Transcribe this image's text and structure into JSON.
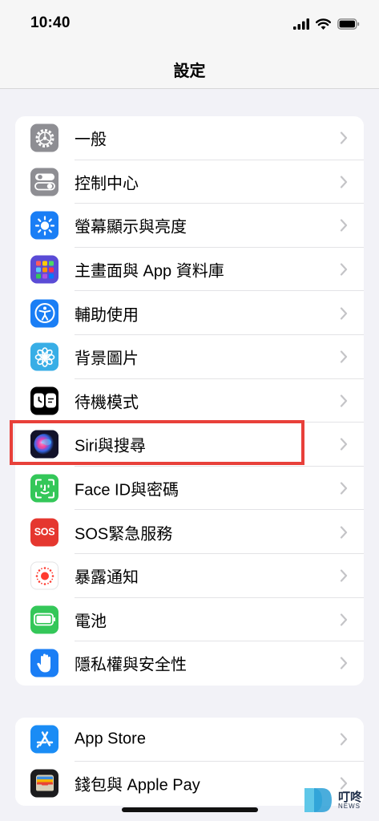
{
  "status_bar": {
    "time": "10:40"
  },
  "nav": {
    "title": "設定"
  },
  "groups": [
    {
      "items": [
        {
          "label": "一般",
          "icon": "gear-icon",
          "icon_bg": "#8e8e93"
        },
        {
          "label": "控制中心",
          "icon": "toggles-icon",
          "icon_bg": "#8e8e93"
        },
        {
          "label": "螢幕顯示與亮度",
          "icon": "sun-icon",
          "icon_bg": "#1a7ef5"
        },
        {
          "label": "主畫面與 App 資料庫",
          "icon": "app-grid-icon",
          "icon_bg": "#5a4bd6"
        },
        {
          "label": "輔助使用",
          "icon": "accessibility-icon",
          "icon_bg": "#1a7ef5"
        },
        {
          "label": "背景圖片",
          "icon": "flower-icon",
          "icon_bg": "#38aee6"
        },
        {
          "label": "待機模式",
          "icon": "standby-icon",
          "icon_bg": "#000000"
        },
        {
          "label": "Siri與搜尋",
          "icon": "siri-icon",
          "icon_bg": "#1b1b3a"
        },
        {
          "label": "Face ID與密碼",
          "icon": "face-id-icon",
          "icon_bg": "#34c759"
        },
        {
          "label": "SOS緊急服務",
          "icon": "sos-icon",
          "icon_bg": "#e5372f",
          "icon_text": "SOS"
        },
        {
          "label": "暴露通知",
          "icon": "exposure-icon",
          "icon_bg": "#ffffff"
        },
        {
          "label": "電池",
          "icon": "battery-icon",
          "icon_bg": "#34c759"
        },
        {
          "label": "隱私權與安全性",
          "icon": "hand-icon",
          "icon_bg": "#1a7ef5"
        }
      ]
    },
    {
      "items": [
        {
          "label": "App Store",
          "icon": "app-store-icon",
          "icon_bg": "#1a8cf5"
        },
        {
          "label": "錢包與 Apple Pay",
          "icon": "wallet-icon",
          "icon_bg": "#1c1c1e"
        }
      ]
    }
  ],
  "highlight_color": "#e8403a",
  "watermark": {
    "title": "叮咚",
    "subtitle": "NEWS"
  }
}
